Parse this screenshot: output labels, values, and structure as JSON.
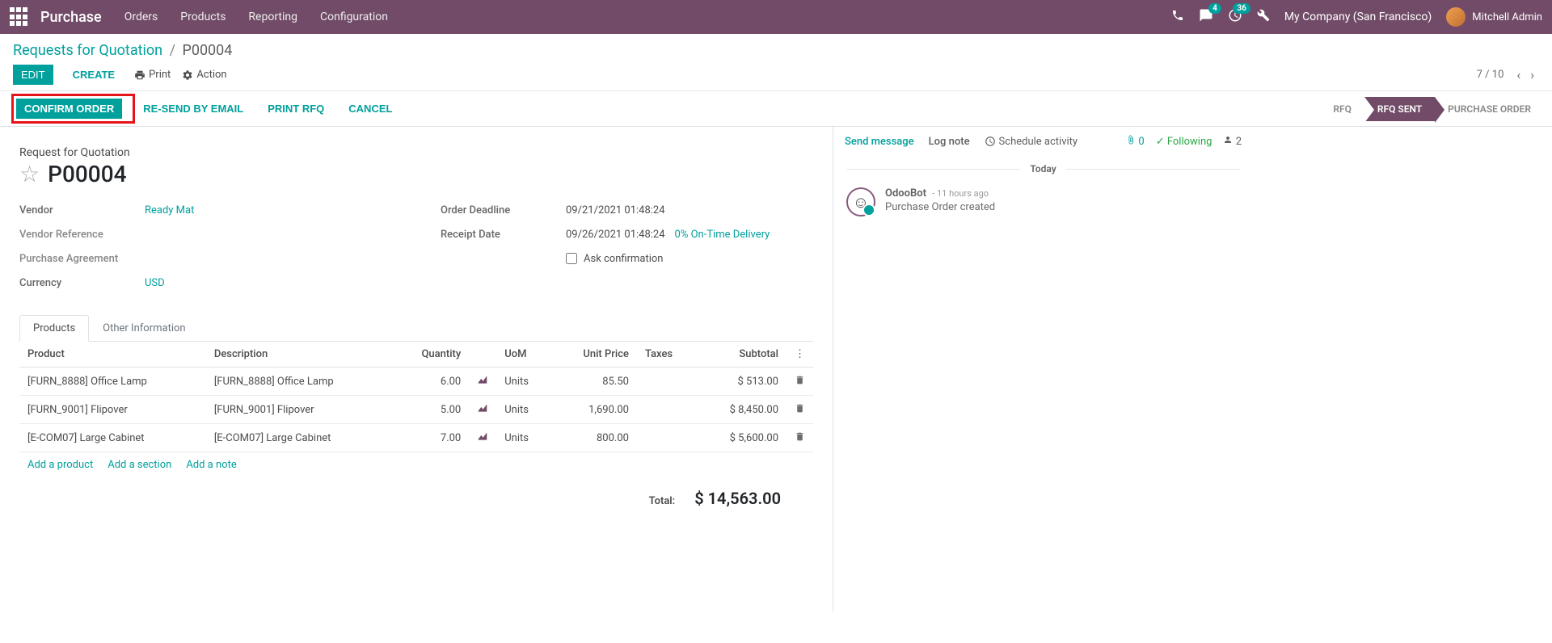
{
  "navbar": {
    "brand": "Purchase",
    "menu": [
      "Orders",
      "Products",
      "Reporting",
      "Configuration"
    ],
    "msg_badge": "4",
    "activity_badge": "36",
    "company": "My Company (San Francisco)",
    "user": "Mitchell Admin"
  },
  "breadcrumb": {
    "root": "Requests for Quotation",
    "current": "P00004"
  },
  "cp": {
    "edit": "EDIT",
    "create": "CREATE",
    "print": "Print",
    "action": "Action",
    "pager": "7 / 10"
  },
  "statusbar": {
    "confirm": "CONFIRM ORDER",
    "resend": "RE-SEND BY EMAIL",
    "printrfq": "PRINT RFQ",
    "cancel": "CANCEL",
    "stages": {
      "rfq": "RFQ",
      "rfq_sent": "RFQ SENT",
      "po": "PURCHASE ORDER"
    }
  },
  "form": {
    "title_label": "Request for Quotation",
    "title_value": "P00004",
    "vendor_label": "Vendor",
    "vendor_value": "Ready Mat",
    "vendor_ref_label": "Vendor Reference",
    "vendor_ref_value": "",
    "purchase_agreement_label": "Purchase Agreement",
    "purchase_agreement_value": "",
    "currency_label": "Currency",
    "currency_value": "USD",
    "deadline_label": "Order Deadline",
    "deadline_value": "09/21/2021 01:48:24",
    "receipt_label": "Receipt Date",
    "receipt_value": "09/26/2021 01:48:24",
    "ontime": "0% On-Time Delivery",
    "ask_confirm": "Ask confirmation"
  },
  "tabs": {
    "products": "Products",
    "other": "Other Information"
  },
  "table": {
    "cols": {
      "product": "Product",
      "desc": "Description",
      "qty": "Quantity",
      "uom": "UoM",
      "price": "Unit Price",
      "taxes": "Taxes",
      "subtotal": "Subtotal"
    },
    "rows": [
      {
        "product": "[FURN_8888] Office Lamp",
        "desc": "[FURN_8888] Office Lamp",
        "qty": "6.00",
        "uom": "Units",
        "price": "85.50",
        "subtotal": "$ 513.00"
      },
      {
        "product": "[FURN_9001] Flipover",
        "desc": "[FURN_9001] Flipover",
        "qty": "5.00",
        "uom": "Units",
        "price": "1,690.00",
        "subtotal": "$ 8,450.00"
      },
      {
        "product": "[E-COM07] Large Cabinet",
        "desc": "[E-COM07] Large Cabinet",
        "qty": "7.00",
        "uom": "Units",
        "price": "800.00",
        "subtotal": "$ 5,600.00"
      }
    ],
    "add_product": "Add a product",
    "add_section": "Add a section",
    "add_note": "Add a note",
    "total_label": "Total:",
    "total_value": "$ 14,563.00"
  },
  "chatter": {
    "send": "Send message",
    "log": "Log note",
    "schedule": "Schedule activity",
    "attach": "0",
    "following": "Following",
    "followers": "2",
    "today": "Today",
    "msg_author": "OdooBot",
    "msg_time": "- 11 hours ago",
    "msg_body": "Purchase Order created"
  }
}
